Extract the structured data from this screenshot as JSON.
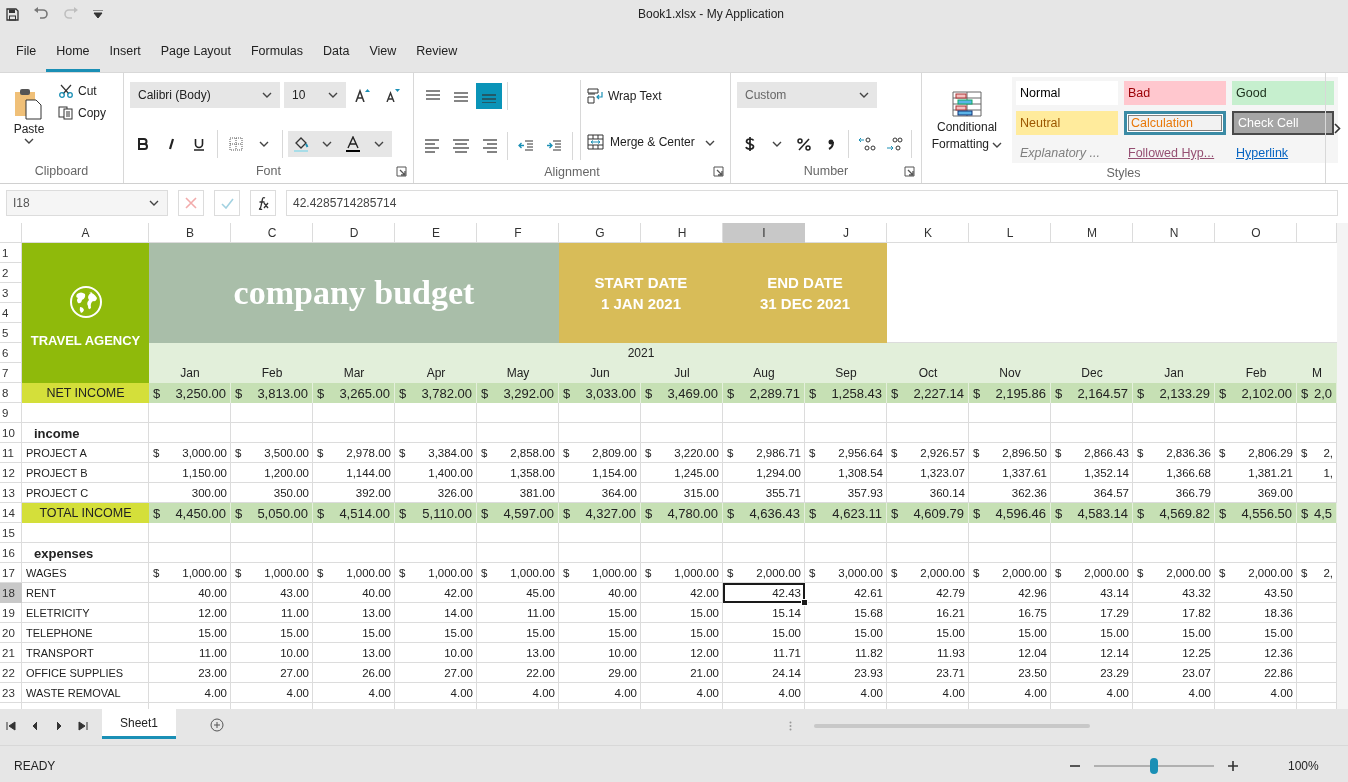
{
  "title_bar": {
    "title": "Book1.xlsx - My Application",
    "undo_disabled": false,
    "redo_disabled": true
  },
  "ribbon_tabs": [
    {
      "label": "File",
      "selected": false
    },
    {
      "label": "Home",
      "selected": true
    },
    {
      "label": "Insert",
      "selected": false
    },
    {
      "label": "Page Layout",
      "selected": false
    },
    {
      "label": "Formulas",
      "selected": false
    },
    {
      "label": "Data",
      "selected": false
    },
    {
      "label": "View",
      "selected": false
    },
    {
      "label": "Review",
      "selected": false
    }
  ],
  "clipboard": {
    "paste": "Paste",
    "cut": "Cut",
    "copy": "Copy",
    "label": "Clipboard"
  },
  "font": {
    "family": "Calibri (Body)",
    "size": "10",
    "label": "Font"
  },
  "alignment": {
    "buttons": [
      {
        "kind": "top",
        "selected": false
      },
      {
        "kind": "middle",
        "selected": false
      },
      {
        "kind": "bottom",
        "selected": true
      },
      {
        "kind": "left",
        "selected": false
      },
      {
        "kind": "center",
        "selected": false
      },
      {
        "kind": "right",
        "selected": false
      }
    ],
    "wrap": "Wrap Text",
    "merge": "Merge & Center",
    "label": "Alignment"
  },
  "number": {
    "format": "Custom",
    "label": "Number"
  },
  "styles": {
    "conditional": "Conditional Formatting",
    "label": "Styles",
    "items": [
      {
        "kind": "normal",
        "label": "Normal",
        "selected": false
      },
      {
        "kind": "bad",
        "label": "Bad",
        "selected": false
      },
      {
        "kind": "good",
        "label": "Good",
        "selected": false
      },
      {
        "kind": "neutral",
        "label": "Neutral",
        "selected": false
      },
      {
        "kind": "calculation",
        "label": "Calculation",
        "selected": true
      },
      {
        "kind": "check",
        "label": "Check Cell",
        "selected": false
      },
      {
        "kind": "explanatory",
        "label": "Explanatory ...",
        "selected": false
      },
      {
        "kind": "followed",
        "label": "Followed Hyp...",
        "selected": false
      },
      {
        "kind": "hyperlink",
        "label": "Hyperlink",
        "selected": false
      }
    ]
  },
  "formula_bar": {
    "name_box": "I18",
    "formula": "42.4285714285714",
    "actions_disabled": true
  },
  "sheet": {
    "columns": [
      {
        "label": "A",
        "selected": false
      },
      {
        "label": "B",
        "selected": false
      },
      {
        "label": "C",
        "selected": false
      },
      {
        "label": "D",
        "selected": false
      },
      {
        "label": "E",
        "selected": false
      },
      {
        "label": "F",
        "selected": false
      },
      {
        "label": "G",
        "selected": false
      },
      {
        "label": "H",
        "selected": false
      },
      {
        "label": "I",
        "selected": true
      },
      {
        "label": "J",
        "selected": false
      },
      {
        "label": "K",
        "selected": false
      },
      {
        "label": "L",
        "selected": false
      },
      {
        "label": "M",
        "selected": false
      },
      {
        "label": "N",
        "selected": false
      },
      {
        "label": "O",
        "selected": false
      }
    ],
    "row_headers": [
      {
        "label": "1",
        "selected": false
      },
      {
        "label": "2",
        "selected": false
      },
      {
        "label": "3",
        "selected": false
      },
      {
        "label": "4",
        "selected": false
      },
      {
        "label": "5",
        "selected": false
      },
      {
        "label": "6",
        "selected": false
      },
      {
        "label": "7",
        "selected": false
      },
      {
        "label": "8",
        "selected": false
      },
      {
        "label": "9",
        "selected": false
      },
      {
        "label": "10",
        "selected": false
      },
      {
        "label": "11",
        "selected": false
      },
      {
        "label": "12",
        "selected": false
      },
      {
        "label": "13",
        "selected": false
      },
      {
        "label": "14",
        "selected": false
      },
      {
        "label": "15",
        "selected": false
      },
      {
        "label": "16",
        "selected": false
      },
      {
        "label": "17",
        "selected": false
      },
      {
        "label": "18",
        "selected": true
      },
      {
        "label": "19",
        "selected": false
      },
      {
        "label": "20",
        "selected": false
      },
      {
        "label": "21",
        "selected": false
      },
      {
        "label": "22",
        "selected": false
      },
      {
        "label": "23",
        "selected": false
      }
    ],
    "banner": {
      "logo_text": "TRAVEL AGENCY",
      "title": "company budget",
      "start_label": "START DATE",
      "start_date": "1 JAN 2021",
      "end_label": "END DATE",
      "end_date": "31 DEC 2021"
    },
    "year": "2021",
    "months": [
      "Jan",
      "Feb",
      "Mar",
      "Apr",
      "May",
      "Jun",
      "Jul",
      "Aug",
      "Sep",
      "Oct",
      "Nov",
      "Dec",
      "Jan",
      "Feb",
      "M"
    ],
    "lines": [
      {
        "kind": "total",
        "label": "NET INCOME",
        "cells": [
          {
            "currency": "$",
            "amount": "3,250.00"
          },
          {
            "currency": "$",
            "amount": "3,813.00"
          },
          {
            "currency": "$",
            "amount": "3,265.00"
          },
          {
            "currency": "$",
            "amount": "3,782.00"
          },
          {
            "currency": "$",
            "amount": "3,292.00"
          },
          {
            "currency": "$",
            "amount": "3,033.00"
          },
          {
            "currency": "$",
            "amount": "3,469.00"
          },
          {
            "currency": "$",
            "amount": "2,289.71"
          },
          {
            "currency": "$",
            "amount": "1,258.43"
          },
          {
            "currency": "$",
            "amount": "2,227.14"
          },
          {
            "currency": "$",
            "amount": "2,195.86"
          },
          {
            "currency": "$",
            "amount": "2,164.57"
          },
          {
            "currency": "$",
            "amount": "2,133.29"
          },
          {
            "currency": "$",
            "amount": "2,102.00"
          },
          {
            "currency": "$",
            "amount": "2,0"
          }
        ]
      },
      {
        "kind": "blank"
      },
      {
        "kind": "section",
        "label": "income"
      },
      {
        "kind": "item",
        "label": "PROJECT A",
        "cells": [
          {
            "currency": "$",
            "amount": "3,000.00"
          },
          {
            "currency": "$",
            "amount": "3,500.00"
          },
          {
            "currency": "$",
            "amount": "2,978.00"
          },
          {
            "currency": "$",
            "amount": "3,384.00"
          },
          {
            "currency": "$",
            "amount": "2,858.00"
          },
          {
            "currency": "$",
            "amount": "2,809.00"
          },
          {
            "currency": "$",
            "amount": "3,220.00"
          },
          {
            "currency": "$",
            "amount": "2,986.71"
          },
          {
            "currency": "$",
            "amount": "2,956.64"
          },
          {
            "currency": "$",
            "amount": "2,926.57"
          },
          {
            "currency": "$",
            "amount": "2,896.50"
          },
          {
            "currency": "$",
            "amount": "2,866.43"
          },
          {
            "currency": "$",
            "amount": "2,836.36"
          },
          {
            "currency": "$",
            "amount": "2,806.29"
          },
          {
            "currency": "$",
            "amount": "2,"
          }
        ]
      },
      {
        "kind": "item",
        "label": "PROJECT B",
        "cells": [
          "1,150.00",
          "1,200.00",
          "1,144.00",
          "1,400.00",
          "1,358.00",
          "1,154.00",
          "1,245.00",
          "1,294.00",
          "1,308.54",
          "1,323.07",
          "1,337.61",
          "1,352.14",
          "1,366.68",
          "1,381.21",
          "1,"
        ]
      },
      {
        "kind": "item",
        "label": "PROJECT C",
        "cells": [
          "300.00",
          "350.00",
          "392.00",
          "326.00",
          "381.00",
          "364.00",
          "315.00",
          "355.71",
          "357.93",
          "360.14",
          "362.36",
          "364.57",
          "366.79",
          "369.00"
        ]
      },
      {
        "kind": "total",
        "label": "TOTAL INCOME",
        "cells": [
          {
            "currency": "$",
            "amount": "4,450.00"
          },
          {
            "currency": "$",
            "amount": "5,050.00"
          },
          {
            "currency": "$",
            "amount": "4,514.00"
          },
          {
            "currency": "$",
            "amount": "5,110.00"
          },
          {
            "currency": "$",
            "amount": "4,597.00"
          },
          {
            "currency": "$",
            "amount": "4,327.00"
          },
          {
            "currency": "$",
            "amount": "4,780.00"
          },
          {
            "currency": "$",
            "amount": "4,636.43"
          },
          {
            "currency": "$",
            "amount": "4,623.11"
          },
          {
            "currency": "$",
            "amount": "4,609.79"
          },
          {
            "currency": "$",
            "amount": "4,596.46"
          },
          {
            "currency": "$",
            "amount": "4,583.14"
          },
          {
            "currency": "$",
            "amount": "4,569.82"
          },
          {
            "currency": "$",
            "amount": "4,556.50"
          },
          {
            "currency": "$",
            "amount": "4,5"
          }
        ]
      },
      {
        "kind": "blank"
      },
      {
        "kind": "section",
        "label": "expenses"
      },
      {
        "kind": "item",
        "label": "WAGES",
        "cells": [
          {
            "currency": "$",
            "amount": "1,000.00"
          },
          {
            "currency": "$",
            "amount": "1,000.00"
          },
          {
            "currency": "$",
            "amount": "1,000.00"
          },
          {
            "currency": "$",
            "amount": "1,000.00"
          },
          {
            "currency": "$",
            "amount": "1,000.00"
          },
          {
            "currency": "$",
            "amount": "1,000.00"
          },
          {
            "currency": "$",
            "amount": "1,000.00"
          },
          {
            "currency": "$",
            "amount": "2,000.00"
          },
          {
            "currency": "$",
            "amount": "3,000.00"
          },
          {
            "currency": "$",
            "amount": "2,000.00"
          },
          {
            "currency": "$",
            "amount": "2,000.00"
          },
          {
            "currency": "$",
            "amount": "2,000.00"
          },
          {
            "currency": "$",
            "amount": "2,000.00"
          },
          {
            "currency": "$",
            "amount": "2,000.00"
          },
          {
            "currency": "$",
            "amount": "2,"
          }
        ]
      },
      {
        "kind": "item",
        "label": "RENT",
        "cells": [
          "40.00",
          "43.00",
          "40.00",
          "42.00",
          "45.00",
          "40.00",
          "42.00",
          "42.43",
          "42.61",
          "42.79",
          "42.96",
          "43.14",
          "43.32",
          "43.50"
        ]
      },
      {
        "kind": "item",
        "label": "ELETRICITY",
        "cells": [
          "12.00",
          "11.00",
          "13.00",
          "14.00",
          "11.00",
          "15.00",
          "15.00",
          "15.14",
          "15.68",
          "16.21",
          "16.75",
          "17.29",
          "17.82",
          "18.36"
        ]
      },
      {
        "kind": "item",
        "label": "TELEPHONE",
        "cells": [
          "15.00",
          "15.00",
          "15.00",
          "15.00",
          "15.00",
          "15.00",
          "15.00",
          "15.00",
          "15.00",
          "15.00",
          "15.00",
          "15.00",
          "15.00",
          "15.00"
        ]
      },
      {
        "kind": "item",
        "label": "TRANSPORT",
        "cells": [
          "11.00",
          "10.00",
          "13.00",
          "10.00",
          "13.00",
          "10.00",
          "12.00",
          "11.71",
          "11.82",
          "11.93",
          "12.04",
          "12.14",
          "12.25",
          "12.36"
        ]
      },
      {
        "kind": "item",
        "label": "OFFICE SUPPLIES",
        "cells": [
          "23.00",
          "27.00",
          "26.00",
          "27.00",
          "22.00",
          "29.00",
          "21.00",
          "24.14",
          "23.93",
          "23.71",
          "23.50",
          "23.29",
          "23.07",
          "22.86"
        ]
      },
      {
        "kind": "item",
        "label": "WASTE REMOVAL",
        "cells": [
          "4.00",
          "4.00",
          "4.00",
          "4.00",
          "4.00",
          "4.00",
          "4.00",
          "4.00",
          "4.00",
          "4.00",
          "4.00",
          "4.00",
          "4.00",
          "4.00"
        ]
      }
    ]
  },
  "sheet_tabs": [
    {
      "label": "Sheet1",
      "selected": true
    }
  ],
  "status": {
    "text": "READY",
    "zoom": {
      "level": 0.5,
      "reading": "100%"
    }
  }
}
